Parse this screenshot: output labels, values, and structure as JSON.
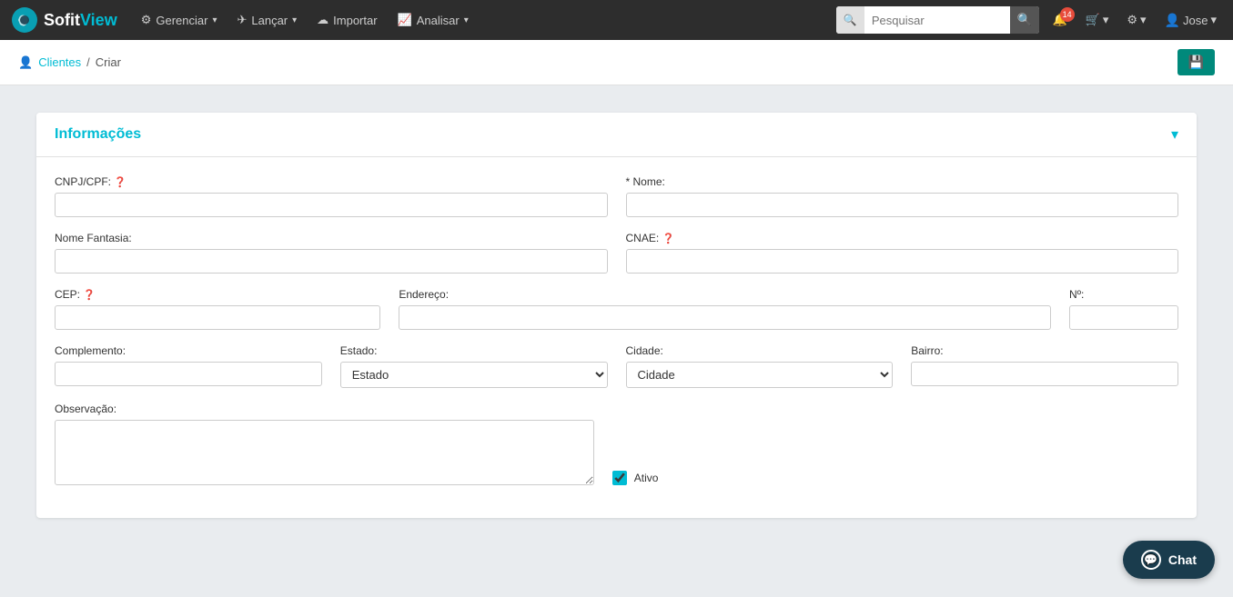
{
  "brand": {
    "sofit": "Sofit",
    "view": "View"
  },
  "navbar": {
    "items": [
      {
        "id": "gerenciar",
        "label": "Gerenciar",
        "has_dropdown": true,
        "icon": "gear"
      },
      {
        "id": "lancar",
        "label": "Lançar",
        "has_dropdown": true,
        "icon": "send"
      },
      {
        "id": "importar",
        "label": "Importar",
        "has_dropdown": false,
        "icon": "cloud-upload"
      },
      {
        "id": "analisar",
        "label": "Analisar",
        "has_dropdown": true,
        "icon": "chart"
      }
    ],
    "search": {
      "prefix": "🔍",
      "placeholder": "Pesquisar"
    },
    "badge_count": "14",
    "user": "Jose"
  },
  "breadcrumb": {
    "link_label": "Clientes",
    "separator": "/",
    "current": "Criar"
  },
  "save_button": "💾",
  "form": {
    "title": "Informações",
    "fields": {
      "cnpj_label": "CNPJ/CPF:",
      "cnpj_placeholder": "",
      "nome_label": "* Nome:",
      "nome_placeholder": "",
      "nome_fantasia_label": "Nome Fantasia:",
      "nome_fantasia_placeholder": "",
      "cnae_label": "CNAE:",
      "cnae_placeholder": "",
      "cep_label": "CEP:",
      "cep_placeholder": "",
      "endereco_label": "Endereço:",
      "endereco_placeholder": "",
      "numero_label": "Nº:",
      "numero_placeholder": "",
      "complemento_label": "Complemento:",
      "complemento_placeholder": "",
      "estado_label": "Estado:",
      "estado_placeholder": "Estado",
      "cidade_label": "Cidade:",
      "cidade_placeholder": "Cidade",
      "bairro_label": "Bairro:",
      "bairro_placeholder": "",
      "observacao_label": "Observação:",
      "observacao_placeholder": "",
      "ativo_label": "Ativo"
    }
  },
  "chat": {
    "label": "Chat"
  }
}
